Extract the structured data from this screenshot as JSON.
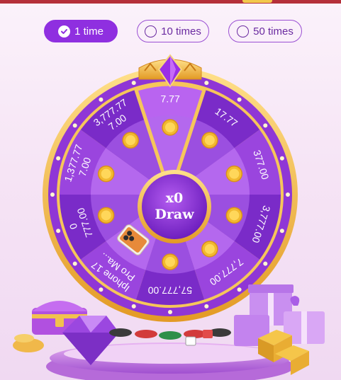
{
  "tabs": [
    {
      "label": "1 time",
      "active": true
    },
    {
      "label": "10 times",
      "active": false
    },
    {
      "label": "50 times",
      "active": false
    }
  ],
  "draw": {
    "multiplier": "x0",
    "label": "Draw"
  },
  "segments": [
    {
      "lines": [
        "7.77"
      ]
    },
    {
      "lines": [
        "17.77"
      ]
    },
    {
      "lines": [
        "377.00"
      ]
    },
    {
      "lines": [
        "3,777.00"
      ]
    },
    {
      "lines": [
        "7,777.00"
      ]
    },
    {
      "lines": [
        "57,777.00"
      ]
    },
    {
      "lines": [
        "Iphone 17",
        "Pro Ma..."
      ],
      "prize_icon": "phone-icon"
    },
    {
      "lines": [
        "0",
        "777.00"
      ]
    },
    {
      "lines": [
        "1,377.77",
        "7.00"
      ]
    },
    {
      "lines": [
        "3,777.77",
        "7.00"
      ]
    }
  ],
  "coin_icon": "coin-icon",
  "decor": {
    "left": "treasure-chest-icon",
    "left2": "diamond-icon",
    "center": "casino-chips-icon",
    "right": "gift-boxes-icon",
    "right2": "gold-bars-icon"
  },
  "colors": {
    "accent": "#8f2fe0",
    "wheel_dark": "#7a2bc8",
    "wheel_light": "#a552e0",
    "rim": "#f3b640"
  }
}
